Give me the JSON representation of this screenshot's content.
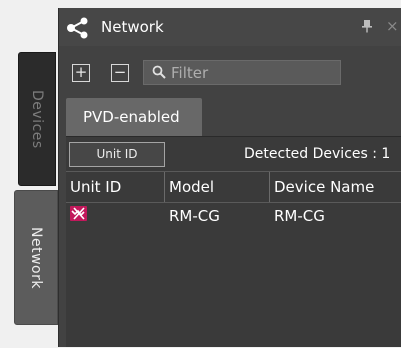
{
  "side_tabs": [
    {
      "label": "Devices"
    },
    {
      "label": "Network"
    }
  ],
  "window": {
    "title": "Network",
    "icon": "network-nodes-icon",
    "pin_icon": "pin-icon",
    "close_icon": "close-icon",
    "close_glyph": "×"
  },
  "toolbar": {
    "expand_glyph": "+",
    "collapse_glyph": "−",
    "filter_placeholder": "Filter",
    "filter_icon": "search-icon"
  },
  "tabs": [
    {
      "label": "PVD-enabled",
      "active": true
    }
  ],
  "list": {
    "unit_id_button": "Unit ID",
    "detected_label": "Detected Devices : 1",
    "columns": [
      "Unit ID",
      "Model",
      "Device Name"
    ],
    "rows": [
      {
        "unit_id_icon": "device-error-icon",
        "model": "RM-CG",
        "device_name": "RM-CG"
      }
    ]
  },
  "colors": {
    "panel_bg": "#424242",
    "content_bg": "#3a3a3a",
    "active_tab_bg": "#686868",
    "device_icon_bg": "#c2185b"
  }
}
